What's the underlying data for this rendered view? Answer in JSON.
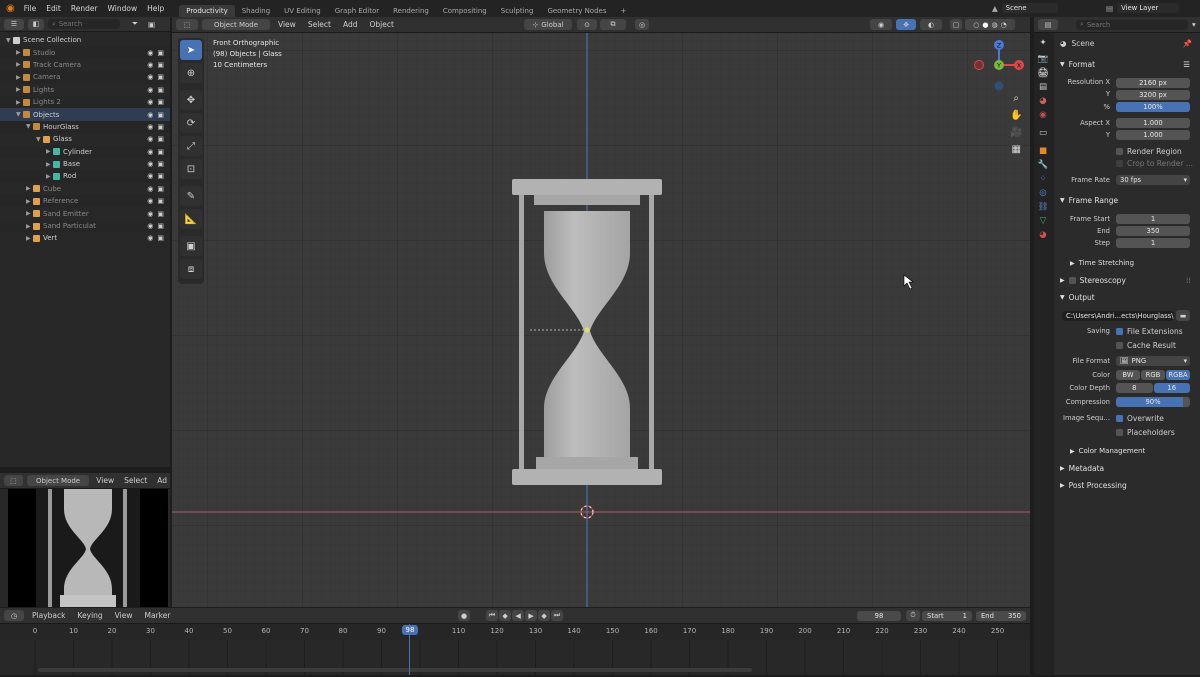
{
  "topbar": {
    "menus": [
      "File",
      "Edit",
      "Render",
      "Window",
      "Help"
    ],
    "workspaces": [
      "Productivity",
      "Shading",
      "UV Editing",
      "Graph Editor",
      "Rendering",
      "Compositing",
      "Sculpting",
      "Geometry Nodes"
    ],
    "active_workspace": "Productivity",
    "add_tab": "+",
    "scene": "Scene",
    "view_layer": "View Layer"
  },
  "outliner": {
    "search_placeholder": "Search",
    "items": [
      {
        "label": "Scene Collection",
        "indent": 0,
        "color": "#cfcfcf",
        "dim": false
      },
      {
        "label": "Studio",
        "indent": 1,
        "color": "#c28a3a",
        "dim": true
      },
      {
        "label": "Track Camera",
        "indent": 1,
        "color": "#c28a3a",
        "dim": true
      },
      {
        "label": "Camera",
        "indent": 1,
        "color": "#c28a3a",
        "dim": true
      },
      {
        "label": "Lights",
        "indent": 1,
        "color": "#c28a3a",
        "dim": true
      },
      {
        "label": "Lights 2",
        "indent": 1,
        "color": "#c28a3a",
        "dim": true
      },
      {
        "label": "Objects",
        "indent": 1,
        "color": "#c28a3a",
        "dim": false,
        "sel": true
      },
      {
        "label": "HourGlass",
        "indent": 2,
        "color": "#c28a3a",
        "dim": false
      },
      {
        "label": "Glass",
        "indent": 3,
        "color": "#e0a050",
        "dim": false
      },
      {
        "label": "Cylinder",
        "indent": 4,
        "color": "#45b8a5",
        "dim": false
      },
      {
        "label": "Base",
        "indent": 4,
        "color": "#45b8a5",
        "dim": false
      },
      {
        "label": "Rod",
        "indent": 4,
        "color": "#45b8a5",
        "dim": false
      },
      {
        "label": "Cube",
        "indent": 2,
        "color": "#e0a050",
        "dim": true
      },
      {
        "label": "Reference",
        "indent": 2,
        "color": "#e0a050",
        "dim": true
      },
      {
        "label": "Sand Emitter",
        "indent": 2,
        "color": "#e0a050",
        "dim": true
      },
      {
        "label": "Sand Particulat",
        "indent": 2,
        "color": "#e0a050",
        "dim": true
      },
      {
        "label": "Vert",
        "indent": 2,
        "color": "#e0a050",
        "dim": false
      }
    ]
  },
  "viewport": {
    "mode": "Object Mode",
    "menus": [
      "View",
      "Select",
      "Add",
      "Object"
    ],
    "orientation": "Global",
    "info_line1": "Front Orthographic",
    "info_line2": "(98) Objects | Glass",
    "info_line3": "10 Centimeters",
    "gizmo": {
      "z": "Z",
      "y": "Y",
      "x": "X"
    }
  },
  "preview": {
    "mode": "Object Mode",
    "menus": [
      "View",
      "Select",
      "Ad"
    ]
  },
  "properties": {
    "search_placeholder": "Search",
    "scene_name": "Scene",
    "format_title": "Format",
    "res_x_label": "Resolution X",
    "res_x": "2160 px",
    "res_y_label": "Y",
    "res_y": "3200 px",
    "res_pct_label": "%",
    "res_pct": "100%",
    "aspect_x_label": "Aspect X",
    "aspect_x": "1.000",
    "aspect_y_label": "Y",
    "aspect_y": "1.000",
    "render_region": "Render Region",
    "crop": "Crop to Render ...",
    "frame_rate_label": "Frame Rate",
    "frame_rate": "30 fps",
    "frame_range_title": "Frame Range",
    "frame_start_label": "Frame Start",
    "frame_start": "1",
    "end_label": "End",
    "end": "350",
    "step_label": "Step",
    "step": "1",
    "time_stretching": "Time Stretching",
    "stereoscopy": "Stereoscopy",
    "output_title": "Output",
    "output_path": "C:\\Users\\Andri...ects\\Hourglass\\",
    "saving_label": "Saving",
    "file_extensions": "File Extensions",
    "cache_result": "Cache Result",
    "file_format_label": "File Format",
    "file_format": "PNG",
    "color_label": "Color",
    "color_opts": [
      "BW",
      "RGB",
      "RGBA"
    ],
    "depth_label": "Color Depth",
    "depth_opts": [
      "8",
      "16"
    ],
    "compression_label": "Compression",
    "compression": "90%",
    "compression_fraction": 0.9,
    "image_seq_label": "Image Sequ...",
    "overwrite": "Overwrite",
    "placeholders": "Placeholders",
    "color_management": "Color Management",
    "metadata": "Metadata",
    "post_processing": "Post Processing"
  },
  "timeline": {
    "menus": [
      "Playback",
      "Keying",
      "View",
      "Marker"
    ],
    "current_frame": "98",
    "start_label": "Start",
    "start": "1",
    "end_label": "End",
    "end": "350",
    "ticks": [
      "0",
      "10",
      "20",
      "30",
      "40",
      "50",
      "60",
      "70",
      "80",
      "90",
      "",
      "110",
      "120",
      "130",
      "140",
      "150",
      "160",
      "170",
      "180",
      "190",
      "200",
      "210",
      "220",
      "230",
      "240",
      "250"
    ],
    "playhead_label": "98"
  }
}
